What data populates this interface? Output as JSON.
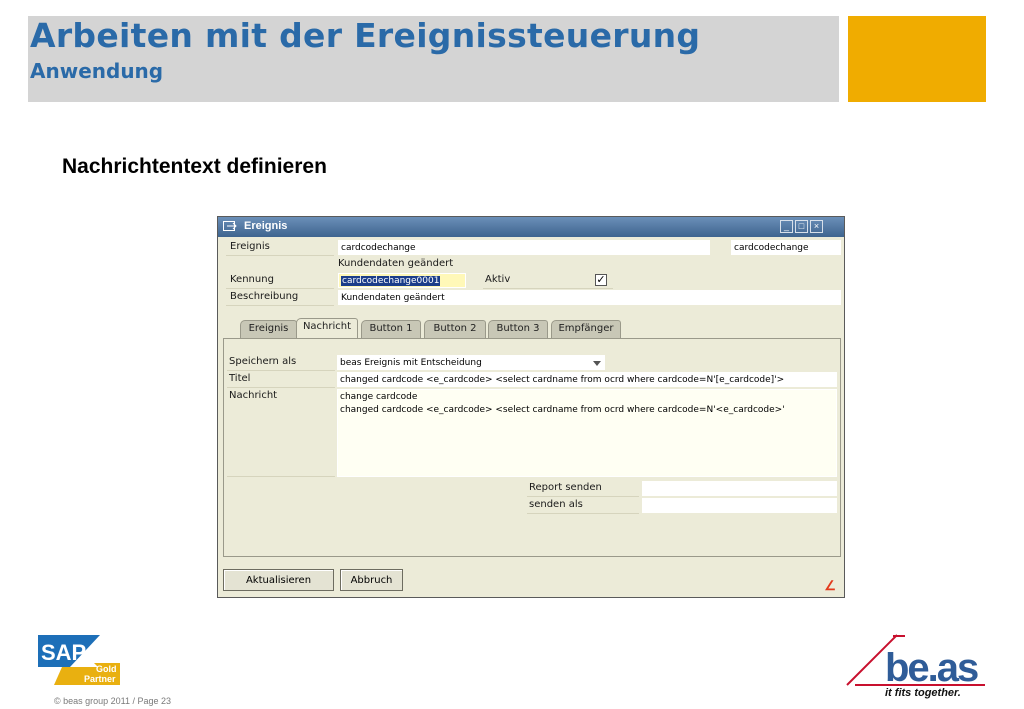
{
  "slide": {
    "title": "Arbeiten mit der Ereignissteuerung",
    "subtitle": "Anwendung",
    "heading": "Nachrichtentext  definieren",
    "footer": "© beas group 2011 / Page 23",
    "colors": {
      "title": "#2a6aa8",
      "header_gray": "#d4d4d4",
      "header_gold": "#f0ac00"
    }
  },
  "window": {
    "title": "Ereignis",
    "controls": {
      "minimize": "_",
      "maximize": "□",
      "close": "×"
    }
  },
  "form": {
    "ereignis_label": "Ereignis",
    "ereignis_value": "cardcodechange",
    "ereignis_value_right": "cardcodechange",
    "ereignis_description": "Kundendaten geändert",
    "kennung_label": "Kennung",
    "kennung_value": "cardcodechange0001",
    "aktiv_label": "Aktiv",
    "aktiv_checked": true,
    "beschreibung_label": "Beschreibung",
    "beschreibung_value": "Kundendaten geändert"
  },
  "tabs": [
    {
      "label": "Ereignis",
      "active": false
    },
    {
      "label": "Nachricht",
      "active": true
    },
    {
      "label": "Button 1",
      "active": false
    },
    {
      "label": "Button 2",
      "active": false
    },
    {
      "label": "Button 3",
      "active": false
    },
    {
      "label": "Empfänger",
      "active": false
    }
  ],
  "nachricht": {
    "speichern_label": "Speichern als",
    "speichern_value": "beas Ereignis mit Entscheidung",
    "titel_label": "Titel",
    "titel_value": "changed cardcode <e_cardcode> <select cardname from ocrd where cardcode=N'[e_cardcode]'>",
    "nachricht_label": "Nachricht",
    "nachricht_line1": "change cardcode",
    "nachricht_line2": "changed cardcode <e_cardcode> <select cardname from ocrd where cardcode=N'<e_cardcode>'",
    "report_label": "Report senden",
    "report_value": "",
    "senden_als_label": "senden als",
    "senden_als_value": ""
  },
  "buttons": {
    "update": "Aktualisieren",
    "cancel": "Abbruch"
  },
  "logos": {
    "sap_text": "SAP",
    "sap_badge_line1": "Gold",
    "sap_badge_line2": "Partner",
    "beas_text": "be.as",
    "beas_tagline": "it fits together."
  }
}
